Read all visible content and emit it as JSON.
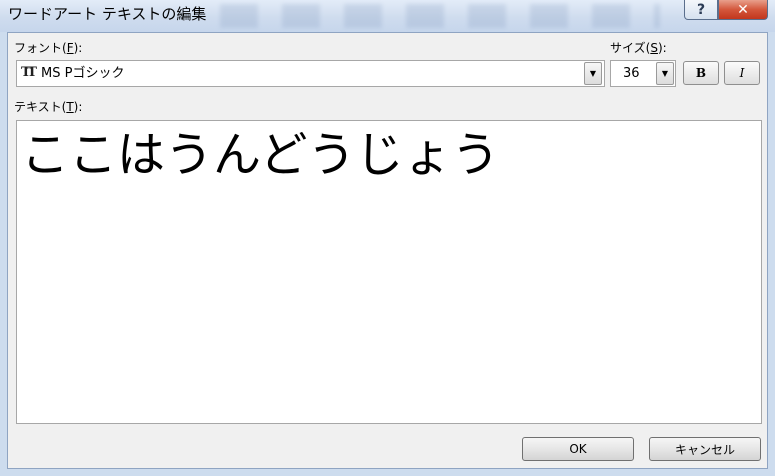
{
  "window": {
    "title": "ワードアート テキストの編集",
    "help_glyph": "?",
    "close_glyph": "✕"
  },
  "font": {
    "label_prefix": "フォント(",
    "label_key": "F",
    "label_suffix": "):",
    "icon_glyph": "TT",
    "value": "MS Pゴシック",
    "dropdown_glyph": "▼"
  },
  "size": {
    "label_prefix": "サイズ(",
    "label_key": "S",
    "label_suffix": "):",
    "value": "36",
    "dropdown_glyph": "▼"
  },
  "style_buttons": {
    "bold_label": "B",
    "italic_label": "I"
  },
  "text": {
    "label_prefix": "テキスト(",
    "label_key": "T",
    "label_suffix": "):",
    "value": "ここはうんどうじょう"
  },
  "buttons": {
    "ok_label": "OK",
    "cancel_label": "キャンセル"
  },
  "colors": {
    "titlebar": "#cfdcee",
    "client_bg": "#f0f0f0",
    "close_button": "#c2361d"
  }
}
